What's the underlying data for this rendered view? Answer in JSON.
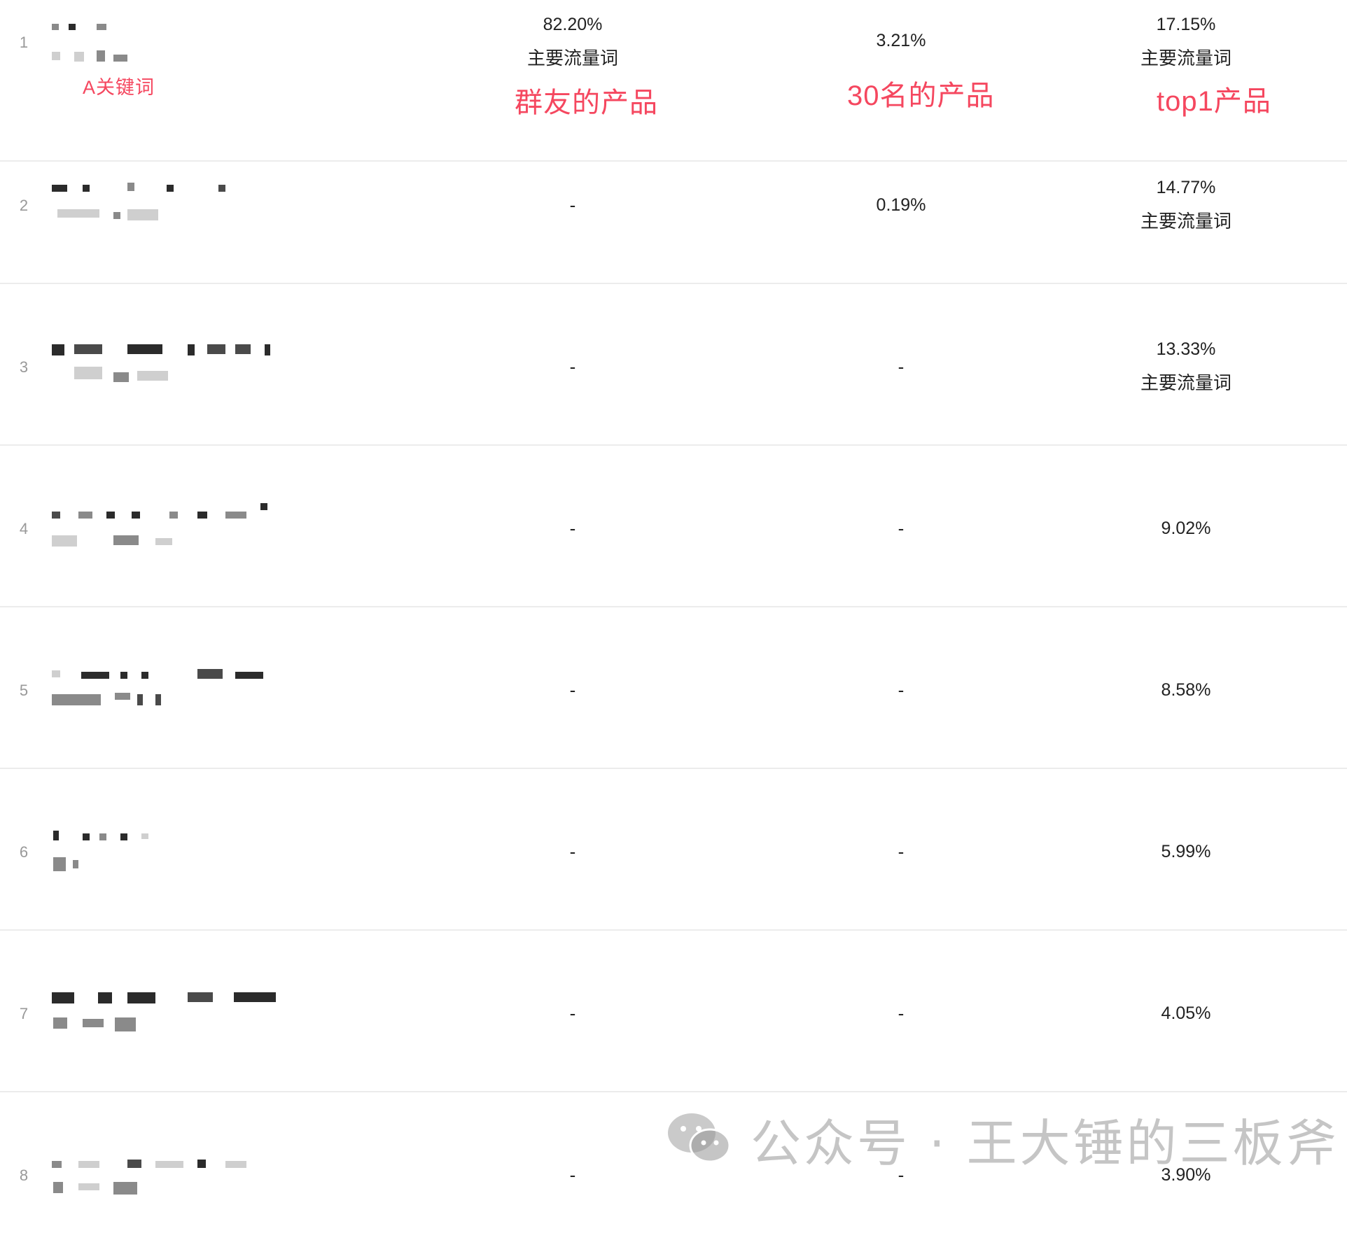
{
  "rows": [
    {
      "index": "1",
      "col1": "82.20%",
      "col1_tag": "主要流量词",
      "col2": "3.21%",
      "col2_tag": "",
      "col3": "17.15%",
      "col3_tag": "主要流量词"
    },
    {
      "index": "2",
      "col1": "-",
      "col1_tag": "",
      "col2": "0.19%",
      "col2_tag": "",
      "col3": "14.77%",
      "col3_tag": "主要流量词"
    },
    {
      "index": "3",
      "col1": "-",
      "col1_tag": "",
      "col2": "-",
      "col2_tag": "",
      "col3": "13.33%",
      "col3_tag": "主要流量词"
    },
    {
      "index": "4",
      "col1": "-",
      "col1_tag": "",
      "col2": "-",
      "col2_tag": "",
      "col3": "9.02%",
      "col3_tag": ""
    },
    {
      "index": "5",
      "col1": "-",
      "col1_tag": "",
      "col2": "-",
      "col2_tag": "",
      "col3": "8.58%",
      "col3_tag": ""
    },
    {
      "index": "6",
      "col1": "-",
      "col1_tag": "",
      "col2": "-",
      "col2_tag": "",
      "col3": "5.99%",
      "col3_tag": ""
    },
    {
      "index": "7",
      "col1": "-",
      "col1_tag": "",
      "col2": "-",
      "col2_tag": "",
      "col3": "4.05%",
      "col3_tag": ""
    },
    {
      "index": "8",
      "col1": "-",
      "col1_tag": "",
      "col2": "-",
      "col2_tag": "",
      "col3": "3.90%",
      "col3_tag": ""
    }
  ],
  "annotations": {
    "keyword_a": "A关键词",
    "col1_label": "群友的产品",
    "col2_label": "30名的产品",
    "col3_label": "top1产品",
    "color": "#f5475f"
  },
  "watermark": {
    "text": "公众号 · 王大锤的三板斧",
    "icon": "wechat-icon"
  }
}
